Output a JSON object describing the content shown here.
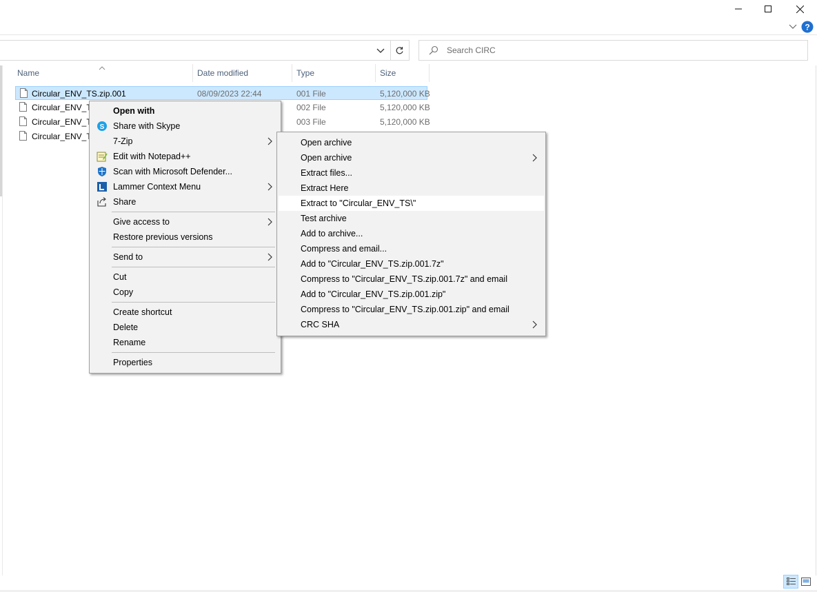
{
  "window": {
    "minimize_icon": "minimize-icon",
    "maximize_icon": "maximize-icon",
    "close_icon": "close-icon",
    "help_icon": "help-icon"
  },
  "search": {
    "placeholder": "Search CIRC"
  },
  "columns": {
    "name": "Name",
    "date": "Date modified",
    "type": "Type",
    "size": "Size"
  },
  "files": [
    {
      "name": "Circular_ENV_TS.zip.001",
      "date": "08/09/2023 22:44",
      "type": "001 File",
      "size": "5,120,000 KB"
    },
    {
      "name": "Circular_ENV_TS",
      "date": "",
      "type": "002 File",
      "size": "5,120,000 KB"
    },
    {
      "name": "Circular_ENV_TS",
      "date": "",
      "type": "003 File",
      "size": "5,120,000 KB"
    },
    {
      "name": "Circular_ENV_TS",
      "date": "",
      "type": "",
      "size": ""
    }
  ],
  "context_menu": {
    "open_with": "Open with",
    "share_skype": "Share with Skype",
    "seven_zip": "7-Zip",
    "edit_notepad": "Edit with Notepad++",
    "scan_defender": "Scan with Microsoft Defender...",
    "lammer": "Lammer Context Menu",
    "share": "Share",
    "give_access": "Give access to",
    "restore": "Restore previous versions",
    "send_to": "Send to",
    "cut": "Cut",
    "copy": "Copy",
    "create_shortcut": "Create shortcut",
    "delete": "Delete",
    "rename": "Rename",
    "properties": "Properties"
  },
  "zip_menu": {
    "open_archive": "Open archive",
    "open_archive_sub": "Open archive",
    "extract_files": "Extract files...",
    "extract_here": "Extract Here",
    "extract_to": "Extract to \"Circular_ENV_TS\\\"",
    "test_archive": "Test archive",
    "add_to_archive": "Add to archive...",
    "compress_email": "Compress and email...",
    "add_7z": "Add to \"Circular_ENV_TS.zip.001.7z\"",
    "compress_7z_email": "Compress to \"Circular_ENV_TS.zip.001.7z\" and email",
    "add_zip": "Add to \"Circular_ENV_TS.zip.001.zip\"",
    "compress_zip_email": "Compress to \"Circular_ENV_TS.zip.001.zip\" and email",
    "crc_sha": "CRC SHA"
  },
  "colors": {
    "selection": "#cce8ff",
    "menu_bg": "#f2f2f2",
    "header_text": "#4c607a"
  }
}
